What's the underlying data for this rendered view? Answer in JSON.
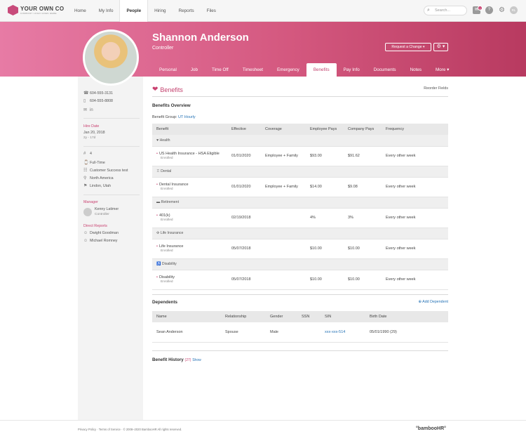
{
  "logo": {
    "line1": "YOUR OWN CO",
    "line2": "COMPANY LOGO GOES HERE"
  },
  "nav": {
    "items": [
      "Home",
      "My Info",
      "People",
      "Hiring",
      "Reports",
      "Files"
    ],
    "active": "People",
    "search_placeholder": "Search...",
    "inbox_count": "7",
    "user_initials": "RL"
  },
  "profile": {
    "name": "Shannon Anderson",
    "title": "Controller",
    "request_button": "Request a Change",
    "gear": "⚙ ▾"
  },
  "tabs": {
    "items": [
      "Personal",
      "Job",
      "Time Off",
      "Timesheet",
      "Emergency",
      "Benefits",
      "Pay Info",
      "Documents",
      "Notes",
      "More"
    ],
    "active": "Benefits"
  },
  "sidebar": {
    "phone1": "604-555-3131",
    "phone2": "604-555-8808",
    "hire_heading": "Hire Date",
    "hire_date": "Jan 20, 2018",
    "tenure": "2y - 17d",
    "emp_num": "4",
    "emp_type": "Full-Time",
    "department": "Customer Success test",
    "division": "North America",
    "location": "Lindon, Utah",
    "manager_heading": "Manager",
    "manager_name": "Kenny Latimer",
    "manager_title": "Controller",
    "reports_heading": "Direct Reports",
    "report1": "Dwight Goodman",
    "report2": "Michael Romney"
  },
  "benefits": {
    "title": "Benefits",
    "reorder": "Reorder Fields",
    "overview": "Benefits Overview",
    "group_label": "Benefit Group:",
    "group_value": "UT Hourly",
    "columns": [
      "Benefit",
      "Effective",
      "Coverage",
      "Employee Pays",
      "Company Pays",
      "Frequency"
    ],
    "groups": [
      {
        "name": "Health",
        "icon": "♥",
        "row": {
          "benefit": "US Health Insurance - HSA Eligible",
          "status": "Enrolled",
          "effective": "01/01/2020",
          "coverage": "Employee + Family",
          "employee": "$93.00",
          "company": "$91.62",
          "frequency": "Every other week"
        }
      },
      {
        "name": "Dental",
        "icon": "♖",
        "row": {
          "benefit": "Dental Insurance",
          "status": "Enrolled",
          "effective": "01/01/2020",
          "coverage": "Employee + Family",
          "employee": "$14.00",
          "company": "$9.08",
          "frequency": "Every other week"
        }
      },
      {
        "name": "Retirement",
        "icon": "▬",
        "row": {
          "benefit": "401(k)",
          "status": "Enrolled",
          "effective": "02/19/2018",
          "coverage": "",
          "employee": "4%",
          "company": "3%",
          "frequency": "Every other week"
        }
      },
      {
        "name": "Life Insurance",
        "icon": "✣",
        "row": {
          "benefit": "Life Insurance",
          "status": "Enrolled",
          "effective": "05/07/2018",
          "coverage": "",
          "employee": "$10.00",
          "company": "$10.00",
          "frequency": "Every other week"
        }
      },
      {
        "name": "Disability",
        "icon": "♿",
        "row": {
          "benefit": "Disability",
          "status": "Enrolled",
          "effective": "05/07/2018",
          "coverage": "",
          "employee": "$10.00",
          "company": "$10.00",
          "frequency": "Every other week"
        }
      }
    ]
  },
  "dependents": {
    "title": "Dependents",
    "add": "Add Dependent",
    "columns": [
      "Name",
      "Relationship",
      "Gender",
      "SSN",
      "SIN",
      "Birth Date"
    ],
    "rows": [
      {
        "name": "Sean Anderson",
        "relationship": "Spouse",
        "gender": "Male",
        "ssn": "",
        "sin": "xxx-xxx-514",
        "birth": "05/01/1990 (29)"
      }
    ]
  },
  "history": {
    "title": "Benefit History",
    "count": "(27)",
    "show": "Show"
  },
  "footer": {
    "text": "Privacy Policy  ·  Terms of Service  ·  © 2008–2020 BambooHR All rights reserved.",
    "brand": "°bambooHR°"
  }
}
